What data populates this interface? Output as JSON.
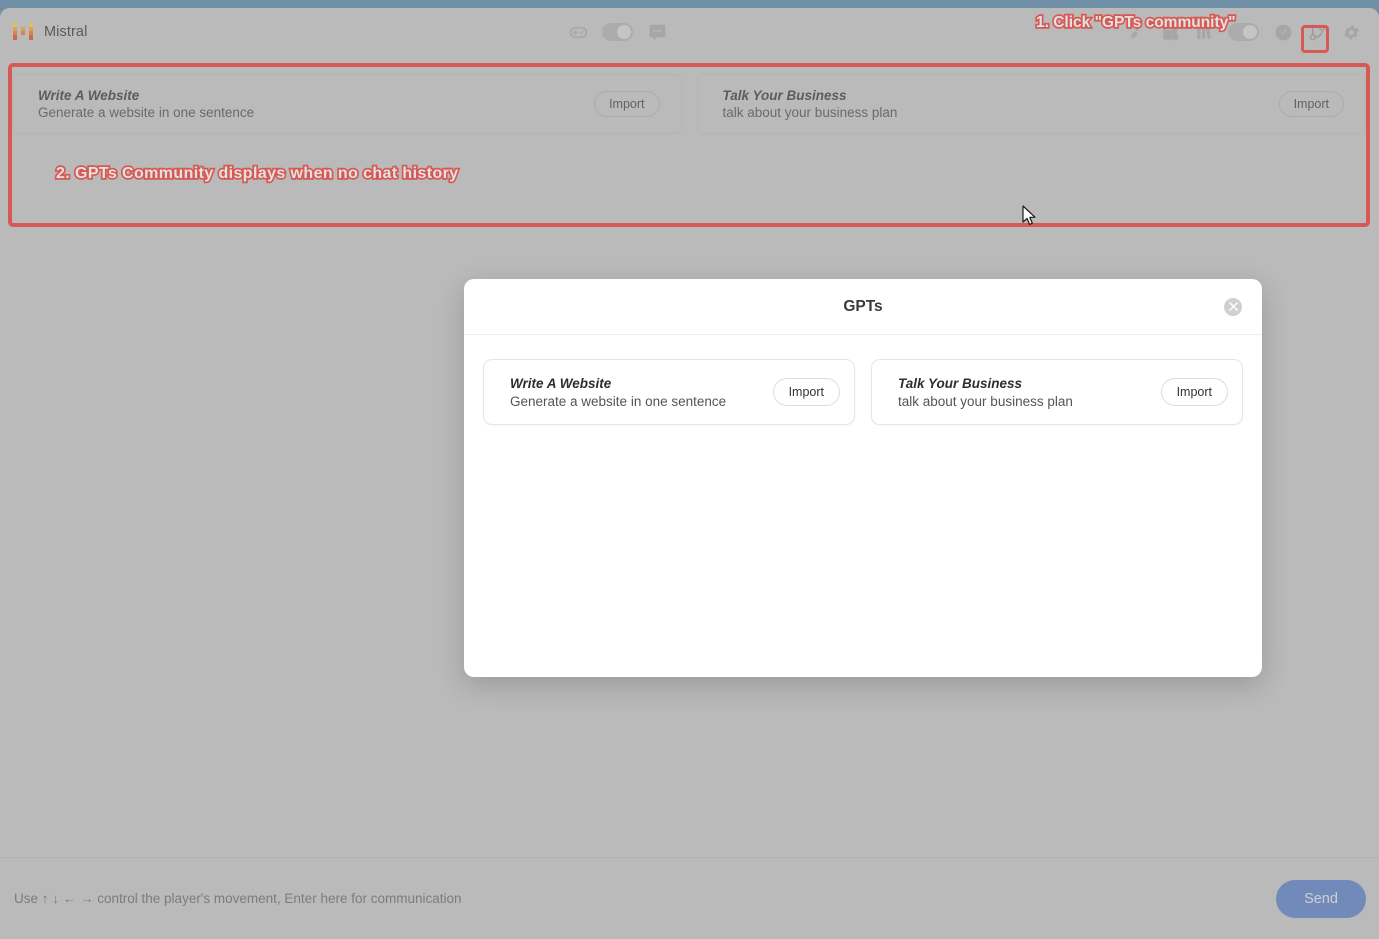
{
  "window": {
    "brand_name": "Mistral",
    "brand_logo_icon": "mistral-logo-icon"
  },
  "toolbar": {
    "center_items": [
      {
        "icon": "gamepad-icon",
        "name": "game-controller"
      },
      {
        "icon": "toggle-switch",
        "name": "mode-toggle"
      },
      {
        "icon": "chat-bubble-icon",
        "name": "chat"
      }
    ],
    "right_items": [
      {
        "icon": "broom-icon",
        "name": "clear-chat"
      },
      {
        "icon": "save-history-icon",
        "name": "save-history"
      },
      {
        "icon": "library-icon",
        "name": "library"
      },
      {
        "icon": "toggle-switch",
        "name": "feature-toggle"
      },
      {
        "icon": "edit-pen-icon",
        "name": "edit-prompt"
      },
      {
        "icon": "git-branch-icon",
        "name": "gpts-community"
      },
      {
        "icon": "gear-icon",
        "name": "settings"
      }
    ]
  },
  "community_strip": {
    "cards": [
      {
        "title": "Write A Website",
        "description": "Generate a website in one sentence",
        "import_label": "Import"
      },
      {
        "title": "Talk Your Business",
        "description": "talk about your business plan",
        "import_label": "Import"
      }
    ]
  },
  "annotations": [
    {
      "text": "1. Click \"GPTs community\""
    },
    {
      "text": "2.  GPTs Community displays when no chat history"
    }
  ],
  "modal": {
    "title": "GPTs",
    "close_icon": "close-icon",
    "cards": [
      {
        "title": "Write A Website",
        "description": "Generate a website in one sentence",
        "import_label": "Import"
      },
      {
        "title": "Talk Your Business",
        "description": "talk about your business plan",
        "import_label": "Import"
      }
    ]
  },
  "composer": {
    "placeholder": "Use ↑ ↓ ← → control the player's movement, Enter here for communication",
    "value": "",
    "send_label": "Send"
  },
  "colors": {
    "annotation_red": "#ef3b33",
    "send_blue": "#5d81c4",
    "app_background": "#c6c6c6",
    "desktop_background": "#6f90a6"
  }
}
